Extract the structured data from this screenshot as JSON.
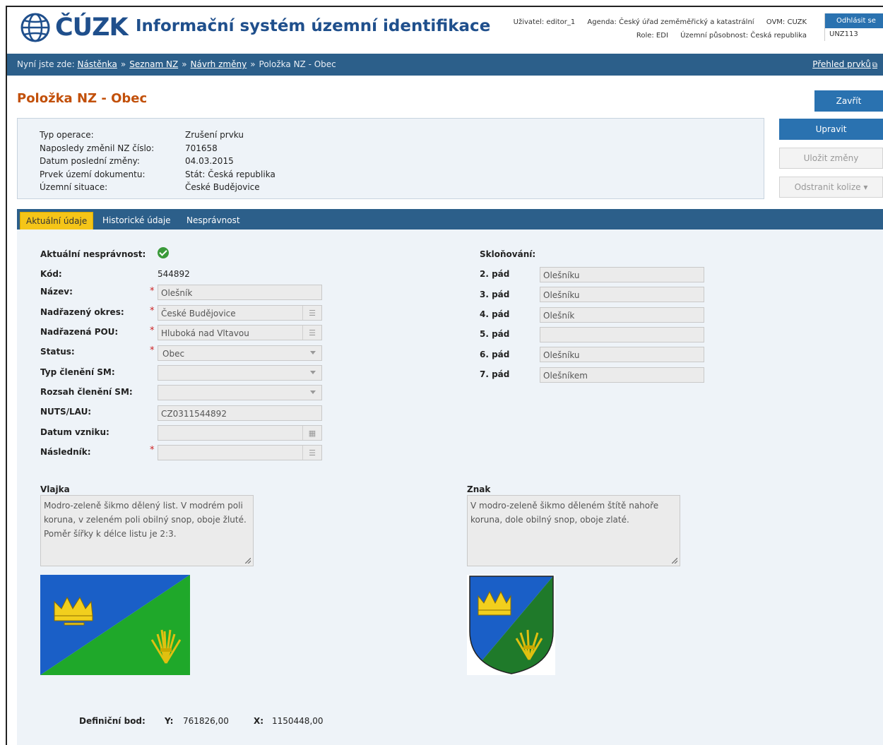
{
  "header": {
    "logo_text": "ČÚZK",
    "app_title": "Informační systém územní identifikace",
    "user_label": "Uživatel: editor_1",
    "agenda_label": "Agenda: Český úřad zeměměřický a katastrální",
    "ovm_label": "OVM: CUZK",
    "role_label": "Role: EDI",
    "territory_label": "Územní působnost: Česká republika",
    "logout_label": "Odhlásit se",
    "unz_code": "UNZ113"
  },
  "breadcrumb": {
    "prefix": "Nyní jste zde:",
    "items": [
      "Nástěnka",
      "Seznam NZ",
      "Návrh změny"
    ],
    "current": "Položka NZ - Obec",
    "separator": "»",
    "overview_link": "Přehled prvků"
  },
  "page": {
    "title": "Položka NZ - Obec"
  },
  "info": {
    "labels": [
      "Typ operace:",
      "Naposledy změnil NZ číslo:",
      "Datum poslední změny:",
      "Prvek území dokumentu:",
      "Územní situace:"
    ],
    "values": [
      "Zrušení prvku",
      "701658",
      "04.03.2015",
      "Stát: Česká republika",
      "České Budějovice"
    ]
  },
  "actions": {
    "close": "Zavřít",
    "edit": "Upravit",
    "save": "Uložit změny",
    "remove_conflicts": "Odstranit kolize ▾"
  },
  "tabs": [
    "Aktuální údaje",
    "Historické údaje",
    "Nesprávnost"
  ],
  "form": {
    "incorrectness_label": "Aktuální nesprávnost:",
    "code_label": "Kód:",
    "code_value": "544892",
    "name_label": "Název:",
    "name_value": "Olešník",
    "district_label": "Nadřazený okres:",
    "district_value": "České Budějovice",
    "pou_label": "Nadřazená POU:",
    "pou_value": "Hluboká nad Vltavou",
    "status_label": "Status:",
    "status_value": "Obec",
    "sm_type_label": "Typ členění SM:",
    "sm_type_value": "",
    "sm_range_label": "Rozsah členění SM:",
    "sm_range_value": "",
    "nuts_label": "NUTS/LAU:",
    "nuts_value": "CZ0311544892",
    "origin_date_label": "Datum vzniku:",
    "origin_date_value": "",
    "successor_label": "Následník:",
    "successor_value": ""
  },
  "declension": {
    "title": "Skloňování:",
    "cases": [
      {
        "label": "2. pád",
        "value": "Olešníku"
      },
      {
        "label": "3. pád",
        "value": "Olešníku"
      },
      {
        "label": "4. pád",
        "value": "Olešník"
      },
      {
        "label": "5. pád",
        "value": ""
      },
      {
        "label": "6. pád",
        "value": "Olešníku"
      },
      {
        "label": "7. pád",
        "value": "Olešníkem"
      }
    ]
  },
  "flag": {
    "title": "Vlajka",
    "description": "Modro-zeleně šikmo dělený list. V modrém poli koruna, v zeleném poli obilný snop, oboje žluté. Poměr šířky k délce listu je 2:3."
  },
  "emblem": {
    "title": "Znak",
    "description": "V modro-zeleně šikmo děleném štítě nahoře koruna, dole obilný snop, oboje zlaté."
  },
  "definition_point": {
    "label": "Definiční bod:",
    "y_label": "Y:",
    "y_value": "761826,00",
    "x_label": "X:",
    "x_value": "1150448,00"
  },
  "colors": {
    "brand_blue": "#1f4f8c",
    "nav_blue": "#2c5f8a",
    "button_blue": "#2a72b0",
    "title_orange": "#c2500a",
    "tab_active": "#f5c518",
    "flag_blue": "#1a5fc7",
    "flag_green": "#1fa82a",
    "gold": "#f2cf1d"
  }
}
